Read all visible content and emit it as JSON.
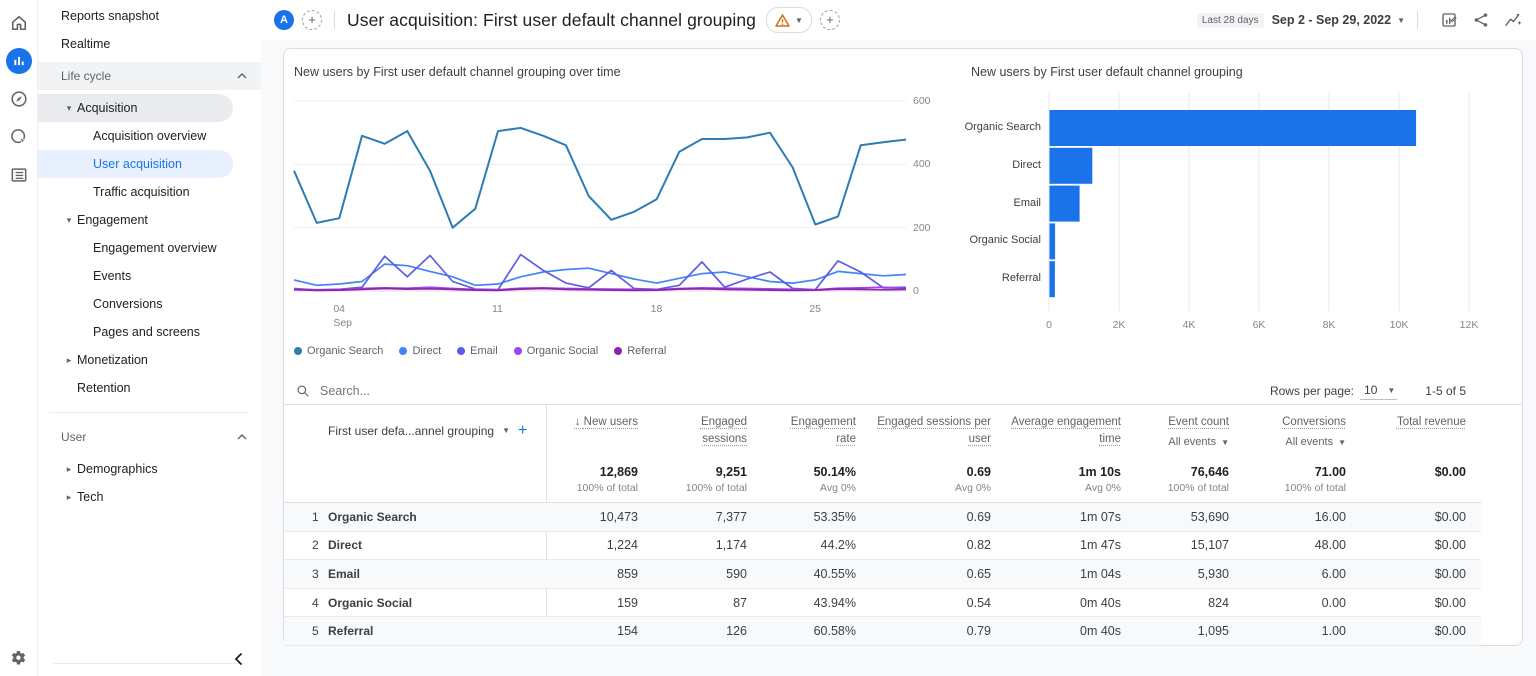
{
  "header": {
    "avatar_letter": "A",
    "title": "User acquisition: First user default channel grouping",
    "date_preset": "Last 28 days",
    "date_range": "Sep 2 - Sep 29, 2022"
  },
  "nav": {
    "reports_snapshot": "Reports snapshot",
    "realtime": "Realtime",
    "life_cycle": "Life cycle",
    "acquisition": "Acquisition",
    "acquisition_overview": "Acquisition overview",
    "user_acquisition": "User acquisition",
    "traffic_acquisition": "Traffic acquisition",
    "engagement": "Engagement",
    "engagement_overview": "Engagement overview",
    "events": "Events",
    "conversions": "Conversions",
    "pages_and_screens": "Pages and screens",
    "monetization": "Monetization",
    "retention": "Retention",
    "user": "User",
    "demographics": "Demographics",
    "tech": "Tech"
  },
  "chart_data": [
    {
      "type": "line",
      "title": "New users by First user default channel grouping over time",
      "ylabel": "",
      "xlabel": "",
      "ylim": [
        0,
        600
      ],
      "y_ticks": [
        600,
        400,
        200,
        0
      ],
      "x_ticks": [
        {
          "label": "04",
          "sub": "Sep",
          "index": 2
        },
        {
          "label": "11",
          "sub": "",
          "index": 9
        },
        {
          "label": "18",
          "sub": "",
          "index": 16
        },
        {
          "label": "25",
          "sub": "",
          "index": 23
        }
      ],
      "x_range_days": 28,
      "legend_position": "bottom",
      "series": [
        {
          "name": "Organic Search",
          "color": "#2d7db3",
          "values": [
            380,
            215,
            230,
            490,
            465,
            505,
            380,
            200,
            260,
            505,
            515,
            490,
            460,
            300,
            225,
            250,
            290,
            440,
            480,
            480,
            485,
            500,
            390,
            210,
            235,
            460,
            470,
            478
          ]
        },
        {
          "name": "Direct",
          "color": "#4285f4",
          "values": [
            35,
            18,
            22,
            30,
            85,
            80,
            62,
            45,
            18,
            22,
            45,
            60,
            68,
            72,
            55,
            38,
            25,
            40,
            55,
            60,
            45,
            30,
            25,
            35,
            62,
            55,
            48,
            52
          ]
        },
        {
          "name": "Email",
          "color": "#5e5ce6",
          "values": [
            8,
            3,
            5,
            12,
            110,
            45,
            112,
            30,
            6,
            4,
            115,
            65,
            25,
            10,
            65,
            8,
            5,
            18,
            92,
            12,
            38,
            60,
            8,
            4,
            95,
            60,
            10,
            12
          ]
        },
        {
          "name": "Organic Social",
          "color": "#a142f4",
          "values": [
            6,
            4,
            5,
            8,
            10,
            9,
            12,
            8,
            5,
            4,
            9,
            10,
            8,
            7,
            6,
            5,
            4,
            8,
            10,
            9,
            8,
            7,
            5,
            4,
            9,
            10,
            12,
            8
          ]
        },
        {
          "name": "Referral",
          "color": "#8e24aa",
          "values": [
            4,
            2,
            3,
            5,
            8,
            6,
            7,
            5,
            3,
            2,
            6,
            8,
            5,
            4,
            3,
            2,
            3,
            6,
            7,
            5,
            4,
            3,
            2,
            3,
            6,
            5,
            4,
            5
          ]
        }
      ]
    },
    {
      "type": "bar",
      "title": "New users by First user default channel grouping",
      "orientation": "horizontal",
      "categories": [
        "Organic Search",
        "Direct",
        "Email",
        "Organic Social",
        "Referral"
      ],
      "values": [
        10473,
        1224,
        859,
        159,
        154
      ],
      "bar_color": "#1a73e8",
      "xlim": [
        0,
        12000
      ],
      "x_ticks": [
        "0",
        "2K",
        "4K",
        "6K",
        "8K",
        "10K",
        "12K"
      ],
      "grid": true
    }
  ],
  "table": {
    "search_placeholder": "Search...",
    "rows_per_page_label": "Rows per page:",
    "rows_per_page_value": "10",
    "pagination_range": "1-5 of 5",
    "dimension_header": "First user defa...annel grouping",
    "columns": [
      {
        "label": "New users",
        "sorted": "desc"
      },
      {
        "label": "Engaged sessions"
      },
      {
        "label": "Engagement rate"
      },
      {
        "label": "Engaged sessions per user"
      },
      {
        "label": "Average engagement time"
      },
      {
        "label": "Event count",
        "filter": "All events"
      },
      {
        "label": "Conversions",
        "filter": "All events"
      },
      {
        "label": "Total revenue"
      }
    ],
    "totals": {
      "values": [
        "12,869",
        "9,251",
        "50.14%",
        "0.69",
        "1m 10s",
        "76,646",
        "71.00",
        "$0.00"
      ],
      "subs": [
        "100% of total",
        "100% of total",
        "Avg 0%",
        "Avg 0%",
        "Avg 0%",
        "100% of total",
        "100% of total",
        ""
      ]
    },
    "rows": [
      {
        "num": "1",
        "name": "Organic Search",
        "values": [
          "10,473",
          "7,377",
          "53.35%",
          "0.69",
          "1m 07s",
          "53,690",
          "16.00",
          "$0.00"
        ]
      },
      {
        "num": "2",
        "name": "Direct",
        "values": [
          "1,224",
          "1,174",
          "44.2%",
          "0.82",
          "1m 47s",
          "15,107",
          "48.00",
          "$0.00"
        ]
      },
      {
        "num": "3",
        "name": "Email",
        "values": [
          "859",
          "590",
          "40.55%",
          "0.65",
          "1m 04s",
          "5,930",
          "6.00",
          "$0.00"
        ]
      },
      {
        "num": "4",
        "name": "Organic Social",
        "values": [
          "159",
          "87",
          "43.94%",
          "0.54",
          "0m 40s",
          "824",
          "0.00",
          "$0.00"
        ]
      },
      {
        "num": "5",
        "name": "Referral",
        "values": [
          "154",
          "126",
          "60.58%",
          "0.79",
          "0m 40s",
          "1,095",
          "1.00",
          "$0.00"
        ]
      }
    ]
  }
}
